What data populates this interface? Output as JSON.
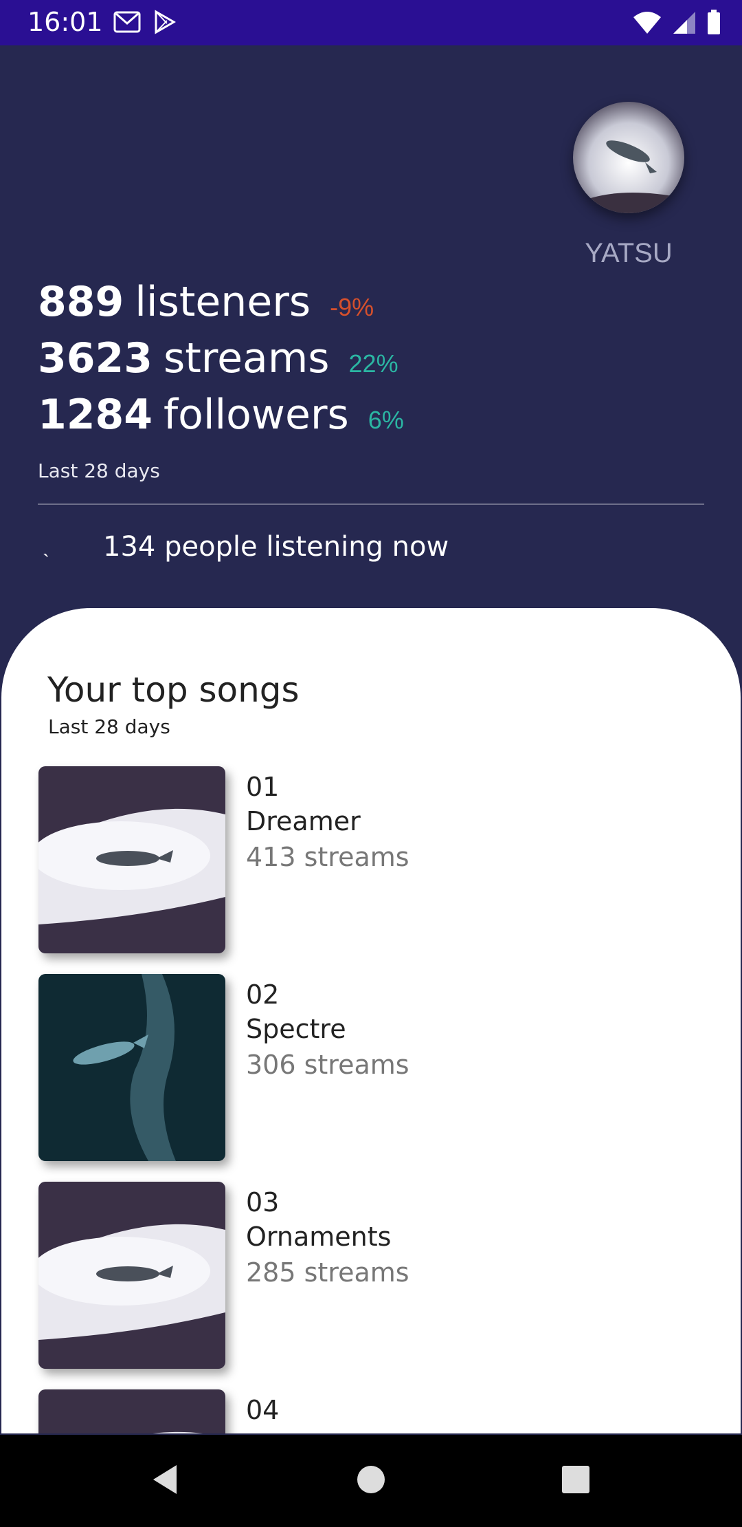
{
  "status_bar": {
    "time": "16:01",
    "left_icons": [
      "gmail-icon",
      "play-store-icon"
    ],
    "right_icons": [
      "wifi-icon",
      "signal-icon",
      "battery-icon"
    ]
  },
  "profile": {
    "artist_name": "YATSU",
    "avatar_icon": "whale-avatar"
  },
  "stats": [
    {
      "number": "889",
      "label": "listeners",
      "change": "-9%",
      "trend": "negative"
    },
    {
      "number": "3623",
      "label": "streams",
      "change": "22%",
      "trend": "positive"
    },
    {
      "number": "1284",
      "label": "followers",
      "change": "6%",
      "trend": "positive"
    }
  ],
  "stats_period": "Last 28 days",
  "live": {
    "mark": "`",
    "text": "134 people listening now"
  },
  "top_songs": {
    "title": "Your top songs",
    "subtitle": "Last 28 days",
    "songs": [
      {
        "rank": "01",
        "title": "Dreamer",
        "streams": "413 streams",
        "cover": "whale-clouds-cover"
      },
      {
        "rank": "02",
        "title": "Spectre",
        "streams": "306 streams",
        "cover": "whale-ocean-cover"
      },
      {
        "rank": "03",
        "title": "Ornaments",
        "streams": "285 streams",
        "cover": "whale-clouds-cover"
      },
      {
        "rank": "04",
        "title": "",
        "streams": "",
        "cover": "whale-clouds-cover"
      }
    ]
  },
  "colors": {
    "status_bar": "#2a0f93",
    "header_bg": "#262850",
    "negative": "#d6502c",
    "positive": "#2bb6a3"
  },
  "nav_icons": [
    "back-icon",
    "home-icon",
    "recents-icon"
  ]
}
